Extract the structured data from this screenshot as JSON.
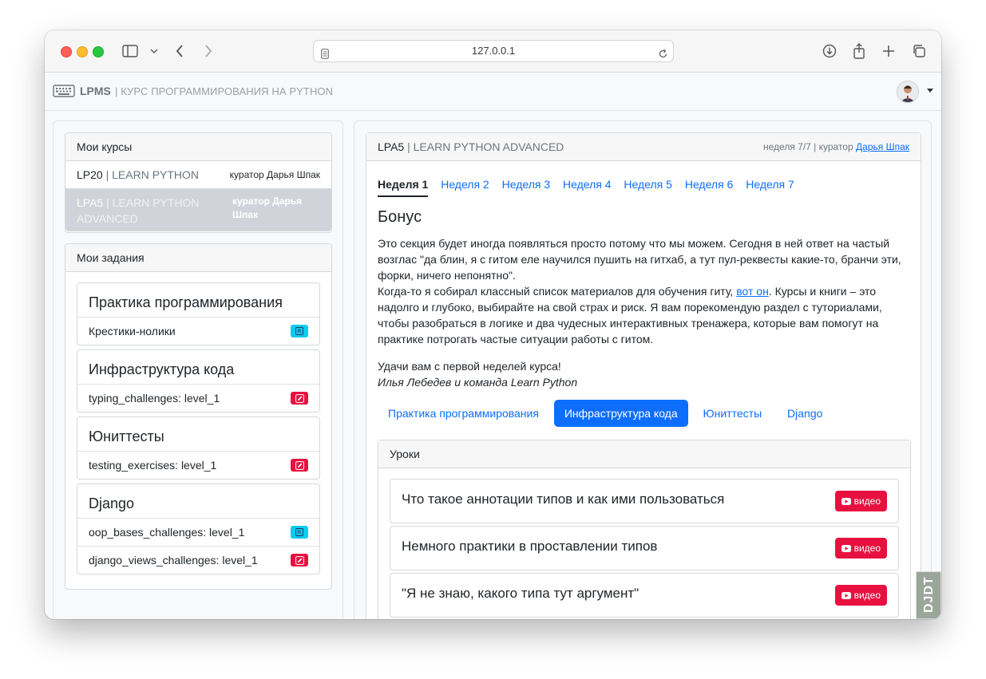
{
  "browser": {
    "url": "127.0.0.1"
  },
  "navbar": {
    "brand": "LPMS",
    "subtitle": "| КУРС ПРОГРАММИРОВАНИЯ НА PYTHON"
  },
  "courses": {
    "header": "Мои курсы",
    "items": [
      {
        "code": "LP20",
        "name": "| LEARN PYTHON",
        "curator": "куратор Дарья Шпак"
      },
      {
        "code": "LPA5",
        "name": "| LEARN PYTHON ADVANCED",
        "curator": "куратор Дарья Шпак"
      }
    ]
  },
  "tasks": {
    "header": "Мои задания",
    "groups": [
      {
        "title": "Практика программирования",
        "items": [
          {
            "label": "Крестики-нолики",
            "badge": "R"
          }
        ]
      },
      {
        "title": "Инфраструктура кода",
        "items": [
          {
            "label": "typing_challenges: level_1",
            "badge": "edit"
          }
        ]
      },
      {
        "title": "Юниттесты",
        "items": [
          {
            "label": "testing_exercises: level_1",
            "badge": "edit"
          }
        ]
      },
      {
        "title": "Django",
        "items": [
          {
            "label": "oop_bases_challenges: level_1",
            "badge": "R"
          },
          {
            "label": "django_views_challenges: level_1",
            "badge": "edit"
          }
        ]
      }
    ]
  },
  "main": {
    "course_code": "LPA5",
    "course_name": "| LEARN PYTHON ADVANCED",
    "meta_prefix": "неделя 7/7 | куратор",
    "curator_link": "Дарья Шпак",
    "weeks": [
      "Неделя 1",
      "Неделя 2",
      "Неделя 3",
      "Неделя 4",
      "Неделя 5",
      "Неделя 6",
      "Неделя 7"
    ],
    "active_week": 0,
    "bonus_title": "Бонус",
    "para1": "Это секция будет иногда появляться просто потому что мы можем. Сегодня в ней ответ на частый возглас \"да блин, я с гитом еле научился пушить на гитхаб, а тут пул-реквесты какие-то, бранчи эти, форки, ничего непонятно\".",
    "para2_before": "Когда-то я собирал классный список материалов для обучения гиту, ",
    "para2_link": "вот он",
    "para2_after": ". Курсы и книги – это надолго и глубоко, выбирайте на свой страх и риск. Я вам порекомендую раздел с туториалами, чтобы разобраться в логике и два чудесных интерактивных тренажера, которые вам помогут на практике потрогать частые ситуации работы с гитом.",
    "para3": "Удачи вам с первой неделей курса!",
    "signature": "Илья Лебедев и команда Learn Python",
    "pills": [
      "Практика программирования",
      "Инфраструктура кода",
      "Юниттесты",
      "Django"
    ],
    "active_pill": 1,
    "lessons_header": "Уроки",
    "lessons": [
      {
        "title": "Что такое аннотации типов и как ими пользоваться",
        "button": "видео"
      },
      {
        "title": "Немного практики в проставлении типов",
        "button": "видео"
      },
      {
        "title": "\"Я не знаю, какого типа тут аргумент\"",
        "button": "видео"
      }
    ]
  },
  "debug_toolbar": "DJDT",
  "colors": {
    "primary": "#0d6efd",
    "danger": "#e8103f",
    "info": "#0dcaf0"
  }
}
